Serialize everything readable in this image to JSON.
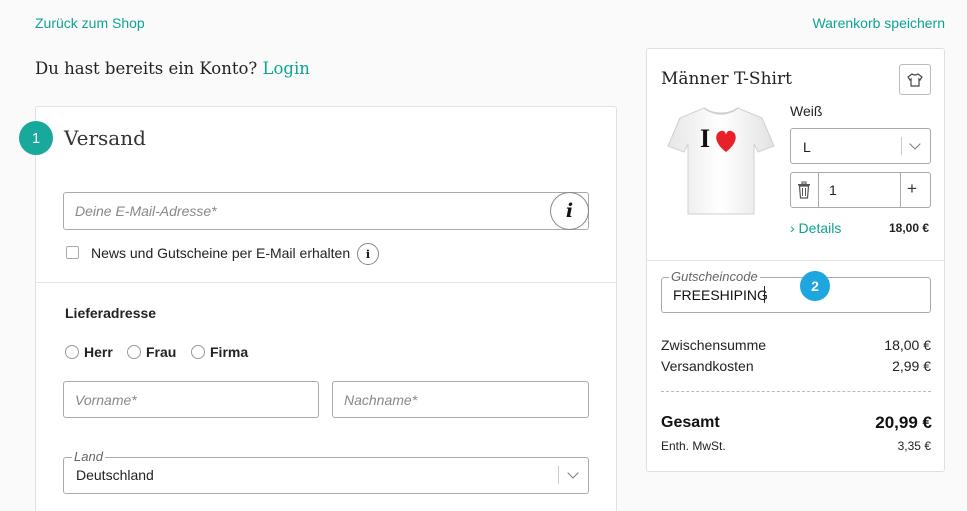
{
  "header": {
    "back_link": "Zurück zum Shop",
    "save_cart_link": "Warenkorb speichern"
  },
  "account": {
    "prompt": "Du hast bereits ein Konto?",
    "login": "Login"
  },
  "shipping": {
    "step": "1",
    "title": "Versand",
    "email_placeholder": "Deine E-Mail-Adresse*",
    "info_glyph": "i",
    "newsletter_label": "News und Gutscheine per E-Mail erhalten",
    "delivery_title": "Lieferadresse",
    "salutations": [
      "Herr",
      "Frau",
      "Firma"
    ],
    "first_name_placeholder": "Vorname*",
    "last_name_placeholder": "Nachname*",
    "country_label": "Land",
    "country_value": "Deutschland"
  },
  "cart": {
    "product_title": "Männer T-Shirt",
    "shirt_print": "I",
    "color": "Weiß",
    "size": "L",
    "quantity": "1",
    "plus": "+",
    "details_link": "› Details",
    "item_price": "18,00 €",
    "coupon_label": "Gutscheincode",
    "coupon_value": "FREESHIPING",
    "coupon_step": "2",
    "subtotal_label": "Zwischensumme",
    "subtotal_value": "18,00 €",
    "shipping_label": "Versandkosten",
    "shipping_value": "2,99 €",
    "total_label": "Gesamt",
    "total_value": "20,99 €",
    "tax_label": "Enth. MwSt.",
    "tax_value": "3,35 €"
  },
  "colors": {
    "accent_green": "#0ea393",
    "step_teal": "#19a99c",
    "step_blue": "#1ea6df",
    "heart_red": "#e8202a"
  }
}
